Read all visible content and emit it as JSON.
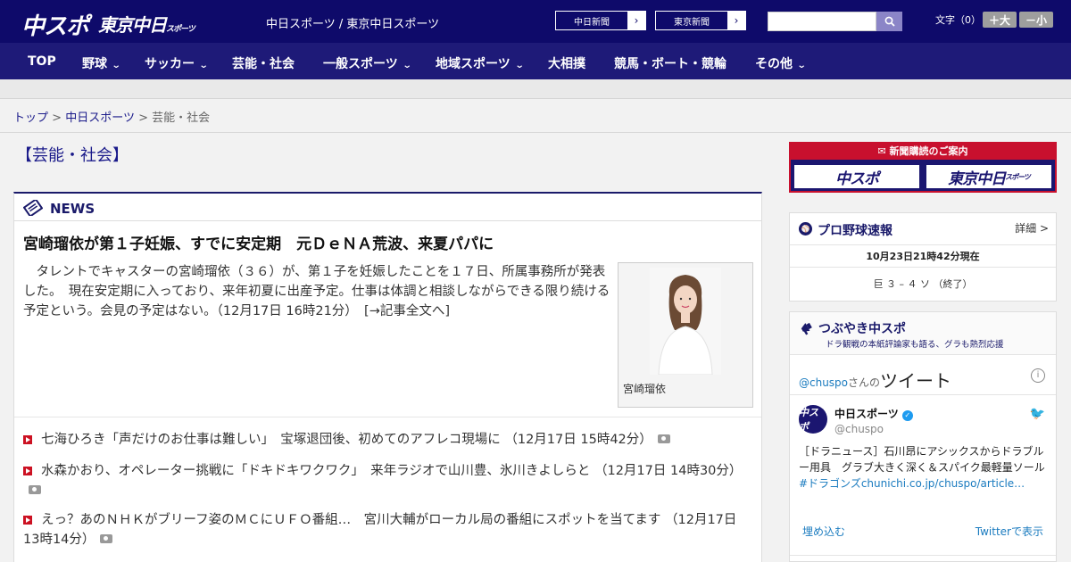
{
  "header": {
    "logo_chuspo": "中スポ",
    "logo_tokyo": "東京中日",
    "logo_tokyo_small": "スポーツ",
    "site_title": "中日スポーツ / 東京中日スポーツ",
    "paper_links": [
      {
        "label": "中日新聞"
      },
      {
        "label": "東京新聞"
      }
    ],
    "search": {
      "value": "",
      "placeholder": ""
    },
    "fontsize_label": "文字（0）",
    "fontsize_up": "＋大",
    "fontsize_down": "－小",
    "colors": {
      "header_bg": "#0e0a6a",
      "nav_bg": "#1e1a78",
      "accent_red": "#cc1122"
    }
  },
  "nav": [
    {
      "label": "TOP",
      "dropdown": false
    },
    {
      "label": "野球",
      "dropdown": true
    },
    {
      "label": "サッカー",
      "dropdown": true
    },
    {
      "label": "芸能・社会",
      "dropdown": false
    },
    {
      "label": "一般スポーツ",
      "dropdown": true
    },
    {
      "label": "地域スポーツ",
      "dropdown": true
    },
    {
      "label": "大相撲",
      "dropdown": false
    },
    {
      "label": "競馬・ボート・競輪",
      "dropdown": false
    },
    {
      "label": "その他",
      "dropdown": true
    }
  ],
  "breadcrumb": {
    "items": [
      "トップ",
      "中日スポーツ",
      "芸能・社会"
    ],
    "separator": ">"
  },
  "section_title": "【芸能・社会】",
  "news": {
    "label": "NEWS",
    "headline": "宮崎瑠依が第１子妊娠、すでに安定期　元ＤｅＮＡ荒波、来夏パパに",
    "lead": "タレントでキャスターの宮崎瑠依（３６）が、第１子を妊娠したことを１７日、所属事務所が発表した。　現在安定期に入っており、来年初夏に出産予定。仕事は体調と相談しながらできる限り続ける予定という。会見の予定はない。（12月17日 16時21分）　[→記事全文へ]",
    "photo_caption": "宮崎瑠依",
    "items": [
      {
        "text": "七海ひろき「声だけのお仕事は難しい」　宝塚退団後、初めてのアフレコ現場に （12月17日 15時42分）",
        "has_photo": true
      },
      {
        "text": "水森かおり、オペレーター挑戦に「ドキドキワクワク」　来年ラジオで山川豊、氷川きよしらと （12月17日 14時30分）",
        "has_photo": true
      },
      {
        "text": "えっ？あのＮＨＫがブリーフ姿のＭＣにＵＦＯ番組…　宮川大輔がローカル局の番組にスポットを当てます （12月17日 13時14分）",
        "has_photo": true
      }
    ]
  },
  "sidebar": {
    "subscribe": {
      "title": "新聞購読のご案内",
      "btn_chuspo": "中スポ",
      "btn_tokyo": "東京中日",
      "btn_tokyo_small": "スポーツ"
    },
    "baseball": {
      "title": "プロ野球速報",
      "detail": "詳細 >",
      "time": "10月23日21時42分現在",
      "result": "巨 ３ – ４ ソ （終了）"
    },
    "twitter": {
      "title": "つぶやき中スポ",
      "subtitle": "ドラ観戦の本紙評論家も語る、グラも熱烈応援",
      "handle": "@chuspo",
      "handle_suffix": "さんの",
      "tweets_label": "ツイート",
      "avatar_text": "中スポ",
      "account_name": "中日スポーツ",
      "account_id": "@chuspo",
      "tweet_text": "［ドラニュース］石川昂にアシックスからドラブルー用具　グラブ大きく深く＆スパイク最軽量ソール",
      "tweet_link": "#ドラゴンズ",
      "tweet_url": "chunichi.co.jp/chuspo/article…",
      "embed": "埋め込む",
      "view": "Twitterで表示"
    }
  }
}
